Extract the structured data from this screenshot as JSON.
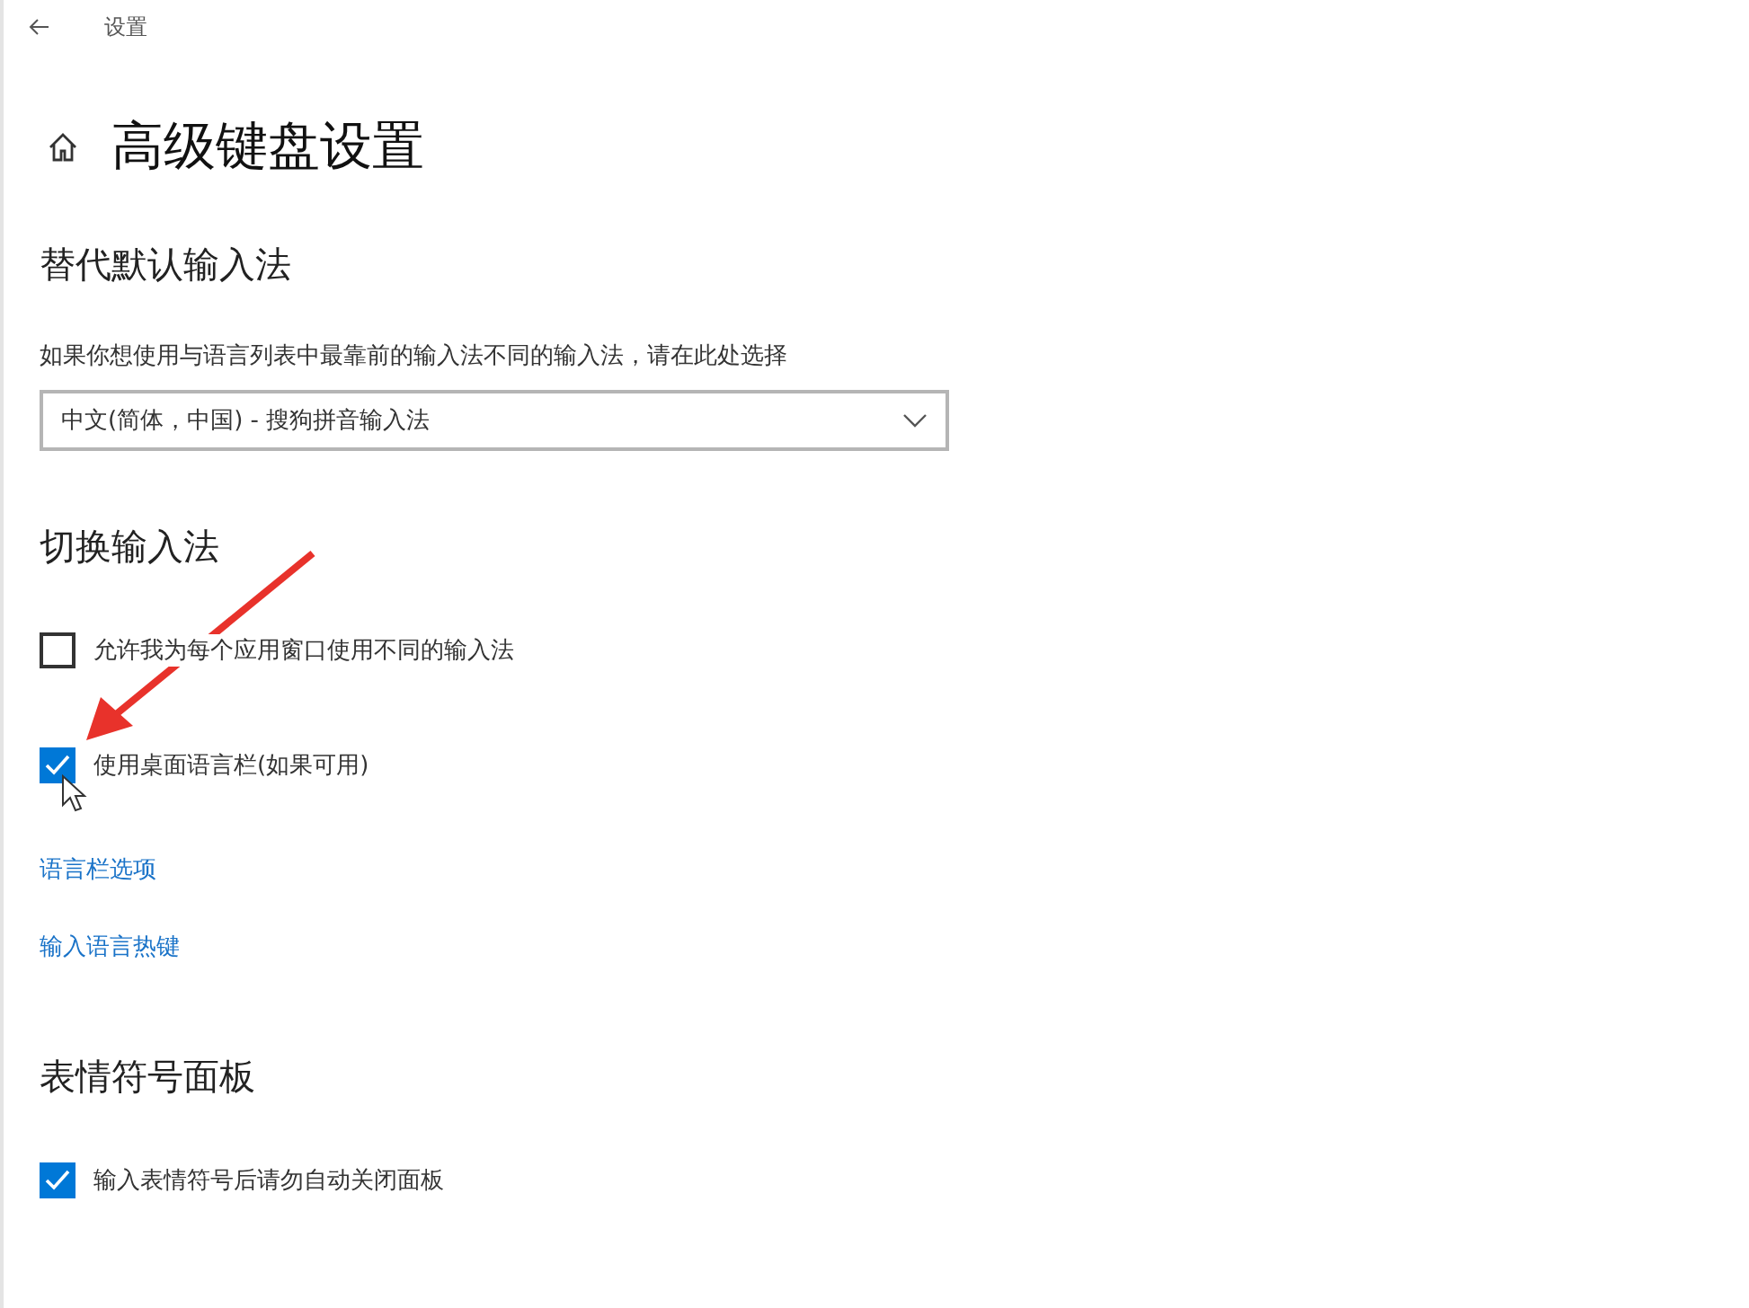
{
  "header": {
    "title": "设置"
  },
  "page": {
    "title": "高级键盘设置"
  },
  "sections": [
    {
      "heading": "替代默认输入法",
      "items": [
        {
          "kind": "text",
          "text": "如果你想使用与语言列表中最靠前的输入法不同的输入法，请在此处选择"
        },
        {
          "kind": "dropdown",
          "value": "中文(简体，中国) - 搜狗拼音输入法"
        }
      ]
    },
    {
      "heading": "切换输入法",
      "items": [
        {
          "kind": "checkbox",
          "label": "允许我为每个应用窗口使用不同的输入法",
          "checked": false
        },
        {
          "kind": "checkbox",
          "label": "使用桌面语言栏(如果可用)",
          "checked": true
        },
        {
          "kind": "link",
          "text": "语言栏选项"
        },
        {
          "kind": "link",
          "text": "输入语言热键"
        }
      ]
    },
    {
      "heading": "表情符号面板",
      "items": [
        {
          "kind": "checkbox",
          "label": "输入表情符号后请勿自动关闭面板",
          "checked": true
        }
      ]
    }
  ]
}
